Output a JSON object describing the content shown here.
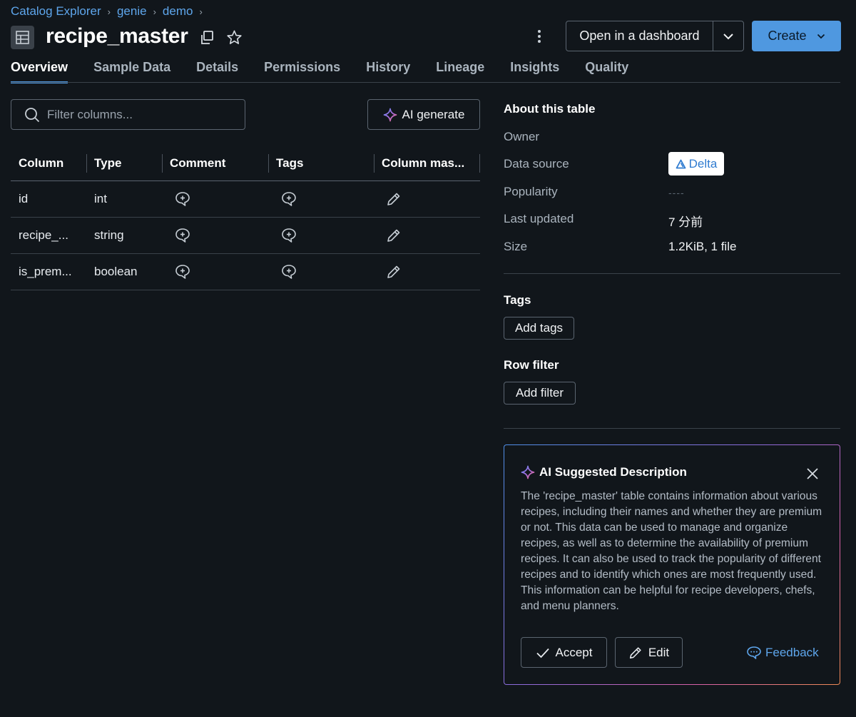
{
  "breadcrumb": [
    "Catalog Explorer",
    "genie",
    "demo"
  ],
  "breadcrumb_separator": "›",
  "title": "recipe_master",
  "header": {
    "open_dashboard_label": "Open in a dashboard",
    "create_label": "Create"
  },
  "tabs": [
    {
      "label": "Overview",
      "active": true
    },
    {
      "label": "Sample Data"
    },
    {
      "label": "Details"
    },
    {
      "label": "Permissions"
    },
    {
      "label": "History"
    },
    {
      "label": "Lineage"
    },
    {
      "label": "Insights"
    },
    {
      "label": "Quality"
    }
  ],
  "filter": {
    "placeholder": "Filter columns..."
  },
  "ai_generate_label": "AI generate",
  "columns_table": {
    "headers": [
      "Column",
      "Type",
      "Comment",
      "Tags",
      "Column mas..."
    ],
    "rows": [
      {
        "column": "id",
        "type": "int"
      },
      {
        "column": "recipe_...",
        "type": "string"
      },
      {
        "column": "is_prem...",
        "type": "boolean"
      }
    ]
  },
  "about": {
    "title": "About this table",
    "owner_label": "Owner",
    "data_source_label": "Data source",
    "data_source_value": "Delta",
    "popularity_label": "Popularity",
    "popularity_value": "----",
    "last_updated_label": "Last updated",
    "last_updated_value": "7 分前",
    "size_label": "Size",
    "size_value": "1.2KiB, 1 file"
  },
  "tags": {
    "title": "Tags",
    "button": "Add tags"
  },
  "row_filter": {
    "title": "Row filter",
    "button": "Add filter"
  },
  "ai_suggestion": {
    "title": "AI Suggested Description",
    "description": "The 'recipe_master' table contains information about various recipes, including their names and whether they are premium or not. This data can be used to manage and organize recipes, as well as to determine the availability of premium recipes. It can also be used to track the popularity of different recipes and to identify which ones are most frequently used. This information can be helpful for recipe developers, chefs, and menu planners.",
    "accept_label": "Accept",
    "edit_label": "Edit",
    "feedback_label": "Feedback"
  },
  "colors": {
    "background": "#11161b",
    "accent": "#4f98e0",
    "link": "#5ea6ec",
    "border": "#5b6570"
  },
  "icons": [
    "table-icon",
    "copy-icon",
    "star-icon",
    "kebab-icon",
    "chevron-down-icon",
    "search-icon",
    "sparkle-icon",
    "comment-add-icon",
    "tag-add-icon",
    "pencil-icon",
    "delta-icon",
    "close-icon",
    "check-icon",
    "feedback-icon"
  ]
}
